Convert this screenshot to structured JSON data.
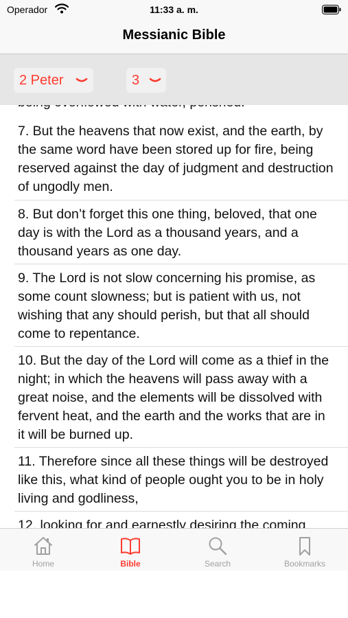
{
  "status_bar": {
    "carrier": "Operador",
    "time": "11:33 a. m."
  },
  "nav": {
    "title": "Messianic Bible"
  },
  "selectors": {
    "book": "2 Peter",
    "chapter": "3"
  },
  "verses": {
    "prev_partial": "being overflowed with water, perished.",
    "v7": "7. But the heavens that now exist, and the earth, by the same word have been stored up for fire, being reserved against the day of judgment and destruction of ungodly men.",
    "v8": "8. But don’t forget this one thing, beloved, that one day is with the Lord as a thousand years, and a thousand years as one day.",
    "v9": "9. The Lord is not slow concerning his promise, as some count slowness; but is patient with us, not wishing that any should perish, but that all should come to repentance.",
    "v10": "10. But the day of the Lord will come as a thief in the night; in which the heavens will pass away with a great noise, and the elements will be dissolved with fervent heat, and the earth and the works that are in it will be burned up.",
    "v11": "11. Therefore since all these things will be destroyed like this, what kind of people ought you to be in holy living and godliness,",
    "v12_partial": "12. looking for and earnestly desiring the coming"
  },
  "tabs": {
    "home": "Home",
    "bible": "Bible",
    "search": "Search",
    "bookmarks": "Bookmarks"
  },
  "colors": {
    "accent": "#ff3b30",
    "inactive": "#a0a0a0"
  }
}
